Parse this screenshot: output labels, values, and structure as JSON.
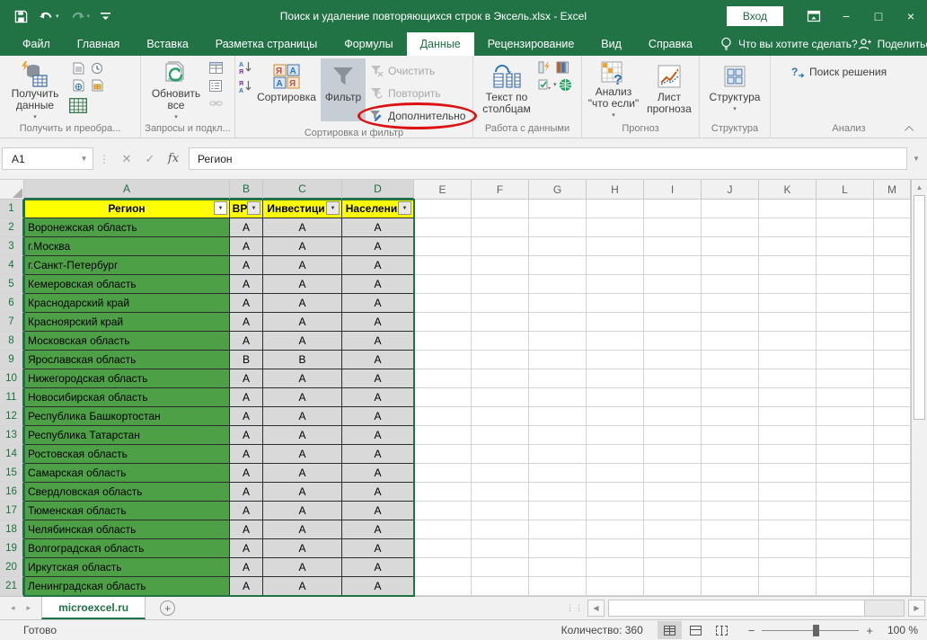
{
  "colors": {
    "titlebar_green": "#217346",
    "accent_green": "#217346",
    "region_fill_green": "#4DA046",
    "header_yellow": "#FFFF00",
    "value_cell_gray": "#D9D9D9",
    "annotation_red": "#DD1111"
  },
  "titlebar": {
    "title": "Поиск и удаление повторяющихся строк в Эксель.xlsx - Excel",
    "sign_in_label": "Вход",
    "qat_icons": [
      "save-icon",
      "undo-icon",
      "redo-icon",
      "customize-qat-icon"
    ],
    "window_icons": [
      "ribbon-display-options-icon",
      "minimize-icon",
      "maximize-icon",
      "close-icon"
    ]
  },
  "tabs": {
    "items": [
      {
        "id": "file",
        "label": "Файл",
        "active": false
      },
      {
        "id": "home",
        "label": "Главная",
        "active": false
      },
      {
        "id": "insert",
        "label": "Вставка",
        "active": false
      },
      {
        "id": "page-layout",
        "label": "Разметка страницы",
        "active": false
      },
      {
        "id": "formulas",
        "label": "Формулы",
        "active": false
      },
      {
        "id": "data",
        "label": "Данные",
        "active": true
      },
      {
        "id": "review",
        "label": "Рецензирование",
        "active": false
      },
      {
        "id": "view",
        "label": "Вид",
        "active": false
      },
      {
        "id": "help",
        "label": "Справка",
        "active": false
      }
    ],
    "tell_me_hint": "Что вы хотите сделать?",
    "share_label": "Поделиться"
  },
  "ribbon": {
    "groups": {
      "get_transform": {
        "label": "Получить и преобра...",
        "get_data": "Получить данные"
      },
      "queries": {
        "label": "Запросы и подкл...",
        "refresh_all": "Обновить все"
      },
      "sort_filter": {
        "label": "Сортировка и фильтр",
        "sort": "Сортировка",
        "filter": "Фильтр",
        "clear": "Очистить",
        "reapply": "Повторить",
        "advanced": "Дополнительно"
      },
      "data_tools": {
        "label": "Работа с данными",
        "text_to_columns": "Текст по столбцам"
      },
      "forecast": {
        "label": "Прогноз",
        "what_if": "Анализ \"что если\"",
        "forecast_sheet": "Лист прогноза"
      },
      "outline": {
        "label": "Структура",
        "structure": "Структура"
      },
      "analysis": {
        "label": "Анализ",
        "solver": "Поиск решения"
      }
    }
  },
  "formula_bar": {
    "name_box": "A1",
    "cancel": "✕",
    "enter": "✓",
    "fx": "fx",
    "value": "Регион"
  },
  "grid": {
    "column_letters": [
      "A",
      "B",
      "C",
      "D",
      "E",
      "F",
      "G",
      "H",
      "I",
      "J",
      "K",
      "L",
      "M"
    ],
    "selected_columns": [
      "A",
      "B",
      "C",
      "D"
    ],
    "selected_rows_count": 21,
    "header_row": {
      "region": "Регион",
      "col_b": "ВР",
      "col_c": "Инвестици",
      "col_d": "Населени"
    },
    "rows": [
      [
        "Воронежская область",
        "А",
        "А",
        "А"
      ],
      [
        "г.Москва",
        "А",
        "А",
        "А"
      ],
      [
        "г.Санкт-Петербург",
        "А",
        "А",
        "А"
      ],
      [
        "Кемеровская область",
        "А",
        "А",
        "А"
      ],
      [
        "Краснодарский край",
        "А",
        "А",
        "А"
      ],
      [
        "Красноярский край",
        "А",
        "А",
        "А"
      ],
      [
        "Московская область",
        "А",
        "А",
        "А"
      ],
      [
        "Ярославская область",
        "В",
        "В",
        "А"
      ],
      [
        "Нижегородская область",
        "А",
        "А",
        "А"
      ],
      [
        "Новосибирская область",
        "А",
        "А",
        "А"
      ],
      [
        "Республика Башкортостан",
        "А",
        "А",
        "А"
      ],
      [
        "Республика Татарстан",
        "А",
        "А",
        "А"
      ],
      [
        "Ростовская область",
        "А",
        "А",
        "А"
      ],
      [
        "Самарская область",
        "А",
        "А",
        "А"
      ],
      [
        "Свердловская область",
        "А",
        "А",
        "А"
      ],
      [
        "Тюменская область",
        "А",
        "А",
        "А"
      ],
      [
        "Челябинская область",
        "А",
        "А",
        "А"
      ],
      [
        "Волгоградская область",
        "А",
        "А",
        "А"
      ],
      [
        "Иркутская область",
        "А",
        "А",
        "А"
      ],
      [
        "Ленинградская область",
        "А",
        "А",
        "А"
      ]
    ]
  },
  "sheet_bar": {
    "active_sheet": "microexcel.ru"
  },
  "status_bar": {
    "ready": "Готово",
    "count": "Количество: 360",
    "zoom_level": "100 %"
  }
}
